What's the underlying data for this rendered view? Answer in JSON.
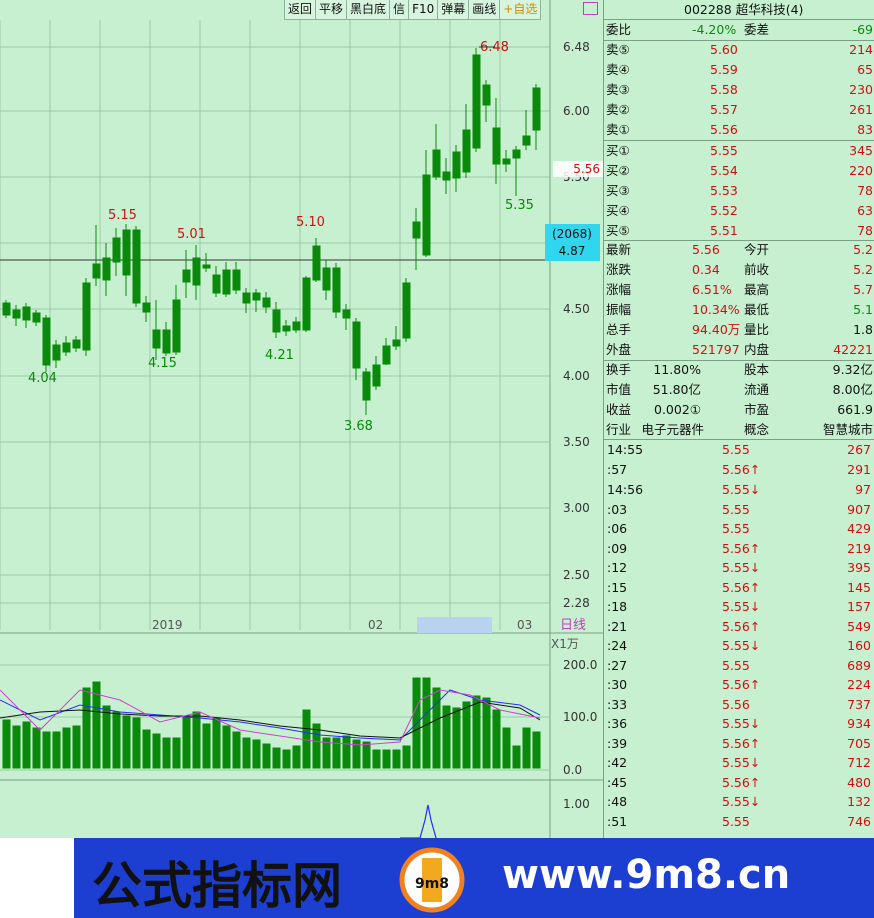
{
  "toolbar": {
    "buttons": [
      "返回",
      "平移",
      "黑白底",
      "信",
      "F10",
      "弹幕",
      "画线",
      "+自选"
    ]
  },
  "chart": {
    "period_label": "日线",
    "unit_label": "X1万",
    "crosshair_label": "(2068)",
    "crosshair_value": "4.87",
    "current_price_marker": "5.56",
    "price_axis": [
      "6.48",
      "6.00",
      "5.50",
      "5.00",
      "4.50",
      "4.00",
      "3.50",
      "3.00",
      "2.50",
      "2.28"
    ],
    "date_labels": [
      "2019",
      "02",
      "03"
    ],
    "volume_axis": [
      "200.0",
      "100.0",
      "0.0"
    ],
    "indicator_axis": [
      "1.00"
    ],
    "annotations": [
      "6.48",
      "5.35",
      "5.15",
      "5.01",
      "5.10",
      "4.04",
      "4.15",
      "4.21",
      "3.68"
    ]
  },
  "quote": {
    "header": "002288 超华科技(4)",
    "weibi_label": "委比",
    "weibi_value": "-4.20%",
    "weicha_label": "委差",
    "weicha_value": "-69",
    "asks": [
      {
        "label": "卖⑤",
        "price": "5.60",
        "vol": "214"
      },
      {
        "label": "卖④",
        "price": "5.59",
        "vol": "65"
      },
      {
        "label": "卖③",
        "price": "5.58",
        "vol": "230"
      },
      {
        "label": "卖②",
        "price": "5.57",
        "vol": "261"
      },
      {
        "label": "卖①",
        "price": "5.56",
        "vol": "83"
      }
    ],
    "bids": [
      {
        "label": "买①",
        "price": "5.55",
        "vol": "345"
      },
      {
        "label": "买②",
        "price": "5.54",
        "vol": "220"
      },
      {
        "label": "买③",
        "price": "5.53",
        "vol": "78"
      },
      {
        "label": "买④",
        "price": "5.52",
        "vol": "63"
      },
      {
        "label": "买⑤",
        "price": "5.51",
        "vol": "78"
      }
    ],
    "stats": [
      {
        "l1": "最新",
        "v1": "5.56",
        "l2": "今开",
        "v2": "5.2"
      },
      {
        "l1": "涨跌",
        "v1": "0.34",
        "l2": "前收",
        "v2": "5.2"
      },
      {
        "l1": "涨幅",
        "v1": "6.51%",
        "l2": "最高",
        "v2": "5.7"
      },
      {
        "l1": "振幅",
        "v1": "10.34%",
        "l2": "最低",
        "v2": "5.1"
      },
      {
        "l1": "总手",
        "v1": "94.40万",
        "l2": "量比",
        "v2": "1.8"
      },
      {
        "l1": "外盘",
        "v1": "521797",
        "l2": "内盘",
        "v2": "42221"
      }
    ],
    "fundamentals": [
      {
        "l1": "换手",
        "v1": "11.80%",
        "l2": "股本",
        "v2": "9.32亿"
      },
      {
        "l1": "市值",
        "v1": "51.80亿",
        "l2": "流通",
        "v2": "8.00亿"
      },
      {
        "l1": "收益",
        "v1": "0.002①",
        "l2": "市盈",
        "v2": "661.9"
      },
      {
        "l1": "行业",
        "v1": "电子元器件",
        "l2": "概念",
        "v2": "智慧城市"
      }
    ],
    "ticks": [
      {
        "time": "14:55",
        "price": "5.55",
        "vol": "267"
      },
      {
        "time": ":57",
        "price": "5.56↑",
        "vol": "291"
      },
      {
        "time": "14:56",
        "price": "5.55↓",
        "vol": "97"
      },
      {
        "time": ":03",
        "price": "5.55",
        "vol": "907"
      },
      {
        "time": ":06",
        "price": "5.55",
        "vol": "429"
      },
      {
        "time": ":09",
        "price": "5.56↑",
        "vol": "219"
      },
      {
        "time": ":12",
        "price": "5.55↓",
        "vol": "395"
      },
      {
        "time": ":15",
        "price": "5.56↑",
        "vol": "145"
      },
      {
        "time": ":18",
        "price": "5.55↓",
        "vol": "157"
      },
      {
        "time": ":21",
        "price": "5.56↑",
        "vol": "549"
      },
      {
        "time": ":24",
        "price": "5.55↓",
        "vol": "160"
      },
      {
        "time": ":27",
        "price": "5.55",
        "vol": "689"
      },
      {
        "time": ":30",
        "price": "5.56↑",
        "vol": "224"
      },
      {
        "time": ":33",
        "price": "5.56",
        "vol": "737"
      },
      {
        "time": ":36",
        "price": "5.55↓",
        "vol": "934"
      },
      {
        "time": ":39",
        "price": "5.56↑",
        "vol": "705"
      },
      {
        "time": ":42",
        "price": "5.55↓",
        "vol": "712"
      },
      {
        "time": ":45",
        "price": "5.56↑",
        "vol": "480"
      },
      {
        "time": ":48",
        "price": "5.55↓",
        "vol": "132"
      },
      {
        "time": ":51",
        "price": "5.55",
        "vol": "746"
      }
    ]
  },
  "banner": {
    "left_text": "公式指标网",
    "right_text": "www.9m8.cn",
    "logo_text": "9m8"
  },
  "colors": {
    "up": "#d01010",
    "down": "#0a8a0a",
    "bg": "#c7f0d0",
    "banner": "#1d3fd1"
  }
}
